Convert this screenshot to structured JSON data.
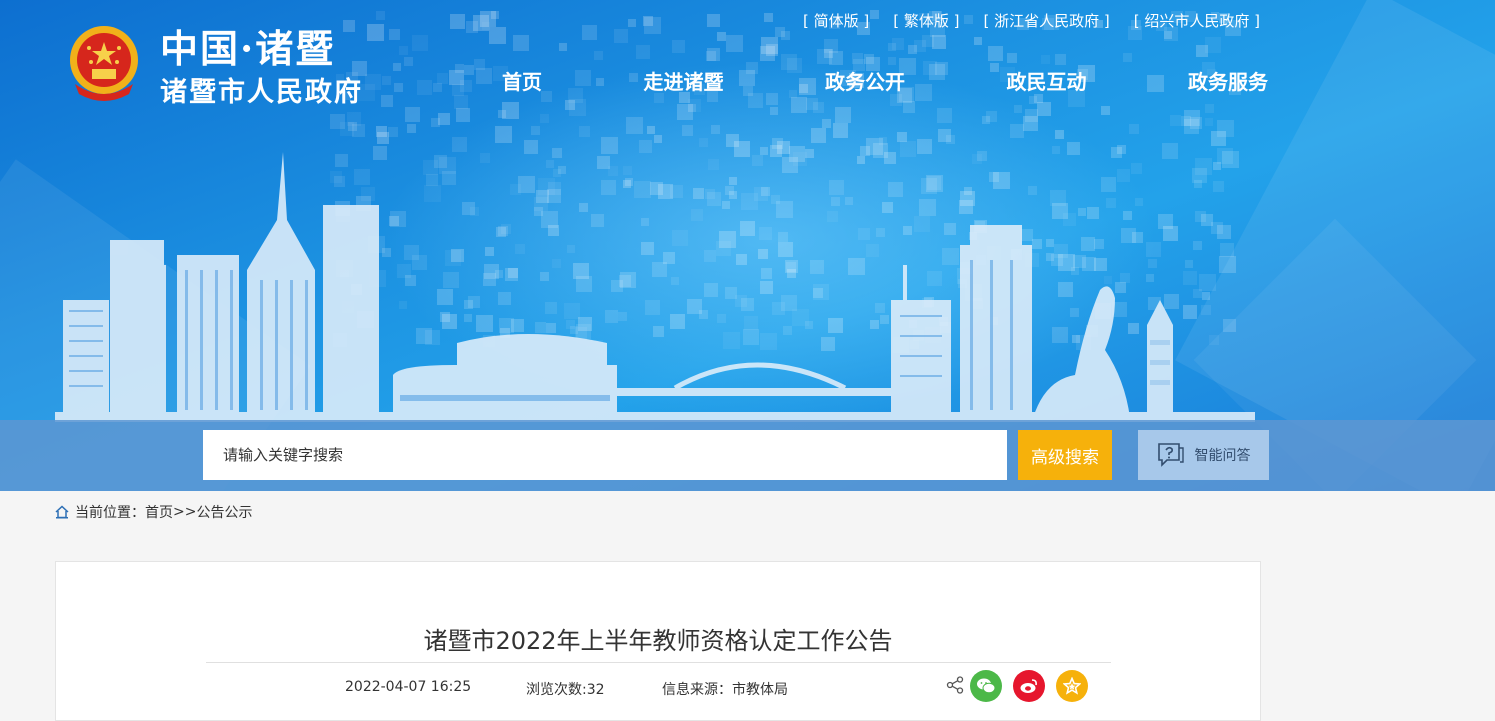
{
  "site": {
    "logo_cn": "中国·诸暨",
    "logo_name": "诸暨市人民政府"
  },
  "toplinks": [
    "[ 简体版 ]",
    "[ 繁体版 ]",
    "[ 浙江省人民政府 ]",
    "[ 绍兴市人民政府 ]"
  ],
  "nav": [
    "首页",
    "走进诸暨",
    "政务公开",
    "政民互动",
    "政务服务"
  ],
  "search": {
    "placeholder": "请输入关键字搜索",
    "advanced_label": "高级搜索",
    "qa_label": "智能问答"
  },
  "breadcrumb": {
    "prefix": "当前位置：",
    "home": "首页",
    "sep": ">>",
    "current": "公告公示"
  },
  "article": {
    "title": "诸暨市2022年上半年教师资格认定工作公告",
    "date": "2022-04-07 16:25",
    "views": "浏览次数:32",
    "source": "信息来源：市教体局"
  },
  "colors": {
    "banner": "#1b8fe0",
    "advanced_button": "#f6b10b",
    "wechat": "#4cb848",
    "weibo": "#e6162d",
    "favorite": "#f6b10b"
  },
  "icons": [
    "national-emblem",
    "home-icon",
    "chat-question-icon",
    "share-icon",
    "wechat-icon",
    "weibo-icon",
    "star-icon"
  ]
}
